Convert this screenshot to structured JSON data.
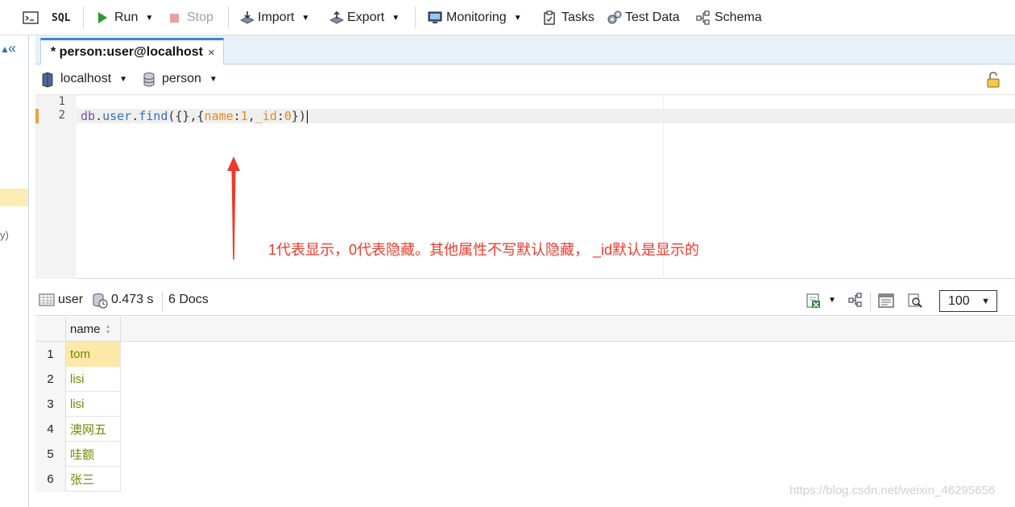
{
  "toolbar": {
    "sql_label": "SQL",
    "run_label": "Run",
    "stop_label": "Stop",
    "import_label": "Import",
    "export_label": "Export",
    "monitoring_label": "Monitoring",
    "tasks_label": "Tasks",
    "testdata_label": "Test Data",
    "schema_label": "Schema"
  },
  "left_panel": {
    "collapse_glyph": "«",
    "paren_text": "y)"
  },
  "tab": {
    "label": "* person:user@localhost",
    "close": "×"
  },
  "connection": {
    "server": "localhost",
    "database": "person"
  },
  "editor": {
    "line_numbers": [
      "1",
      "2"
    ],
    "code": {
      "obj": "db",
      "dot1": ".",
      "collection": "user",
      "dot2": ".",
      "method": "find",
      "args_open": "({},{",
      "key1": "name",
      "colon1": ":",
      "val1": "1",
      "comma": ",",
      "key2": "_id",
      "colon2": ":",
      "val2": "0",
      "args_close": "})"
    },
    "annotation": "1代表显示，0代表隐藏。其他属性不写默认隐藏， _id默认是显示的"
  },
  "result": {
    "collection": "user",
    "time": "0.473 s",
    "docs": "6 Docs",
    "page_size": "100"
  },
  "grid": {
    "column": "name",
    "rows": [
      {
        "num": "1",
        "name": "tom"
      },
      {
        "num": "2",
        "name": "lisi"
      },
      {
        "num": "3",
        "name": "lisi"
      },
      {
        "num": "4",
        "name": "澳网五"
      },
      {
        "num": "5",
        "name": "哇额"
      },
      {
        "num": "6",
        "name": "张三"
      }
    ]
  },
  "watermark": "https://blog.csdn.net/weixin_46295656",
  "colors": {
    "accent": "#3d86d6",
    "annotation": "#ee3a2d",
    "selected_cell": "#fce9a7",
    "value_text": "#6e8a00"
  }
}
